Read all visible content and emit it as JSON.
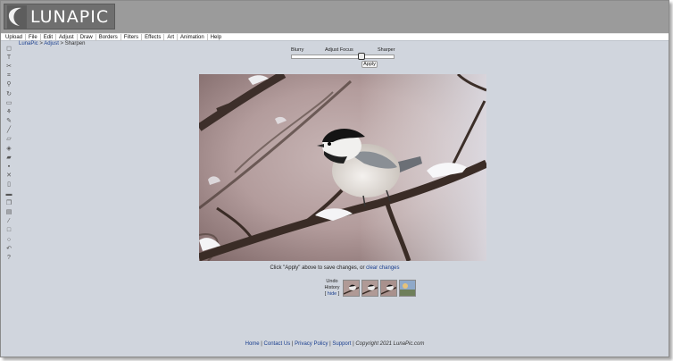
{
  "app": {
    "logo_text": "LUNAPIC"
  },
  "menu": [
    {
      "label": "Upload"
    },
    {
      "label": "File"
    },
    {
      "label": "Edit"
    },
    {
      "label": "Adjust"
    },
    {
      "label": "Draw"
    },
    {
      "label": "Borders"
    },
    {
      "label": "Filters"
    },
    {
      "label": "Effects"
    },
    {
      "label": "Art"
    },
    {
      "label": "Animation"
    },
    {
      "label": "Help"
    }
  ],
  "breadcrumb": {
    "root": "LunaPic",
    "sep1": " > ",
    "section": "Adjust",
    "sep2": " > ",
    "current": "Sharpen"
  },
  "adjust": {
    "label_left": "Blurry",
    "label_center": "Adjust Focus",
    "label_right": "Sharper",
    "slider_value_fraction": 0.68,
    "apply_label": "Apply"
  },
  "hint": {
    "text": "Click \"Apply\" above to save changes, or ",
    "link": "clear changes"
  },
  "history": {
    "line1": "Undo",
    "line2": "History",
    "hide_open": "[ ",
    "hide_link": "hide",
    "hide_close": " ]"
  },
  "footer": {
    "home": "Home",
    "contact": "Contact Us",
    "privacy": "Privacy Policy",
    "support": "Support",
    "sep": " | ",
    "copyright": "Copyright 2021 LunaPic.com"
  },
  "tools": [
    "select-icon",
    "text-icon",
    "scissors-icon",
    "crop-icon",
    "zoom-icon",
    "rotate-icon",
    "layer-icon",
    "brush-icon",
    "pencil-icon",
    "eyedropper-icon",
    "folder-icon",
    "eraser-icon",
    "stamp-icon",
    "save-icon",
    "close-icon",
    "page-icon",
    "print-icon",
    "copy-icon",
    "paste-icon",
    "line-icon",
    "rectangle-icon",
    "circle-icon",
    "undo-icon",
    "help-icon"
  ],
  "colors": {
    "header_bg": "#9b9b9b",
    "page_bg": "#d0d5dd",
    "link": "#1a3f8f"
  }
}
